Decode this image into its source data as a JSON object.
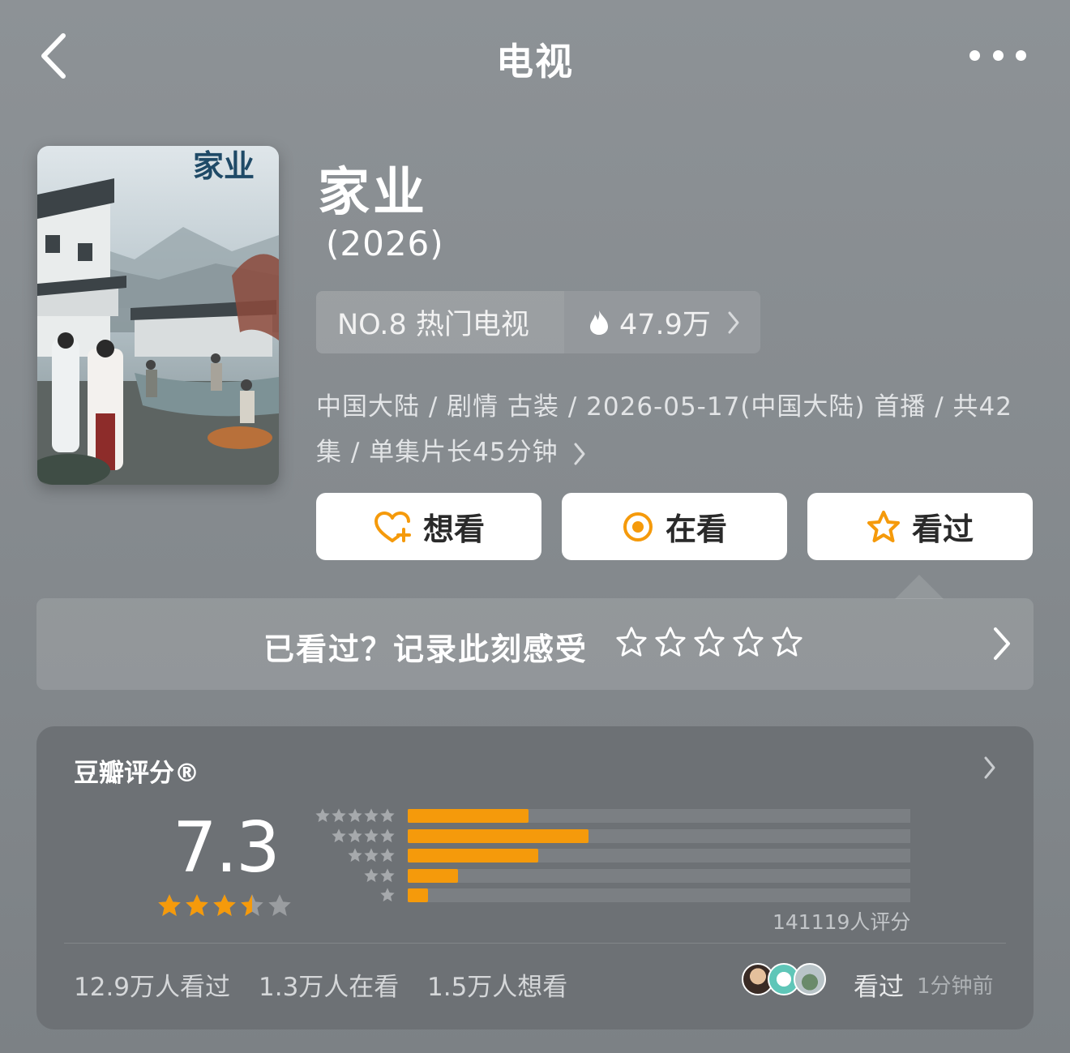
{
  "nav": {
    "title": "电视"
  },
  "poster": {
    "title_calligraphy": "家业"
  },
  "show": {
    "title": "家业",
    "year": "(2026)",
    "rank_label": "NO.8 热门电视",
    "heat_value": "47.9万",
    "meta": "中国大陆 / 剧情 古装 / 2026-05-17(中国大陆) 首播 / 共42集 / 单集片长45分钟"
  },
  "actions": {
    "want": "想看",
    "watching": "在看",
    "watched": "看过"
  },
  "record": {
    "prompt": "已看过？记录此刻感受"
  },
  "rating": {
    "title": "豆瓣评分®",
    "score": "7.3",
    "star_value": 3.5,
    "raters": "141119人评分",
    "distribution": [
      {
        "stars": 5,
        "fraction": 0.24
      },
      {
        "stars": 4,
        "fraction": 0.36
      },
      {
        "stars": 3,
        "fraction": 0.26
      },
      {
        "stars": 2,
        "fraction": 0.1
      },
      {
        "stars": 1,
        "fraction": 0.04
      }
    ],
    "stats": {
      "watched": "12.9万人看过",
      "watching": "1.3万人在看",
      "want": "1.5万人想看"
    },
    "friend": {
      "action": "看过",
      "time": "1分钟前"
    }
  },
  "colors": {
    "accent": "#f59a0b",
    "card": "#6d7175"
  }
}
